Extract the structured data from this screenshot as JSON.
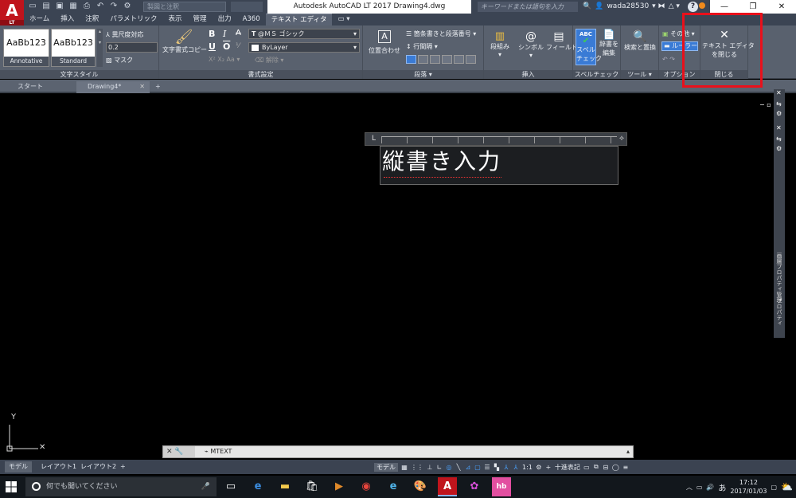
{
  "titlebar": {
    "title": "Autodesk AutoCAD LT 2017    Drawing4.dwg",
    "workspace": "製図と注釈",
    "search_placeholder": "キーワードまたは語句を入力",
    "username": "wada28530",
    "minimize": "—",
    "restore": "❐",
    "close": "✕",
    "logo": "A",
    "logo_sub": "LT",
    "help": "?"
  },
  "ribbon_tabs": [
    "ホーム",
    "挿入",
    "注釈",
    "パラメトリック",
    "表示",
    "管理",
    "出力",
    "A360",
    "テキスト エディタ",
    "▭ ▾"
  ],
  "active_tab_index": 8,
  "ribbon": {
    "style_panel": {
      "sample_text": "AaBb123",
      "style1": "Annotative",
      "style2": "Standard",
      "annotative_label": "異尺度対応",
      "height_value": "0.2",
      "mask_label": "マスク",
      "title": "文字スタイル"
    },
    "format_panel": {
      "match_label": "文字書式コピー",
      "bold": "B",
      "italic": "I",
      "strike": "A",
      "underline": "U",
      "overline": "O",
      "font_value": "@ＭＳ ゴシック",
      "color_value": "ByLayer",
      "clear_label": "解除",
      "title": "書式設定"
    },
    "paragraph_panel": {
      "justify_label": "位置合わせ",
      "bullets_label": "箇条書きと段落番号",
      "line_spacing_label": "行間隔",
      "title": "段落"
    },
    "insert_panel": {
      "columns_label": "段組み",
      "symbol_label": "シンボル",
      "field_label": "フィールド",
      "title": "挿入"
    },
    "spell_panel": {
      "abc": "ABC",
      "spell_label1": "スペル",
      "spell_label2": "チェック",
      "dict_label1": "辞書を",
      "dict_label2": "編集",
      "title": "スペルチェック"
    },
    "tools_panel": {
      "find_label": "検索と置換",
      "title": "ツール"
    },
    "options_panel": {
      "more_label": "その他",
      "ruler_label": "ルーラー",
      "title": "オプション"
    },
    "close_panel": {
      "close_icon": "✕",
      "close_label1": "テキスト エディタ",
      "close_label2": "を閉じる",
      "title": "閉じる"
    }
  },
  "doc_tabs": {
    "start": "スタート",
    "drawing": "Drawing4*",
    "add": "+"
  },
  "mtext": {
    "content": "縦書き入力"
  },
  "right_palette": {
    "label1": "プロパティ",
    "label2": "画層プロパティ管理"
  },
  "commandline": {
    "command": "MTEXT"
  },
  "layout_tabs": [
    "モデル",
    "レイアウト1",
    "レイアウト2"
  ],
  "status": {
    "model": "モデル",
    "scale": "1:1",
    "units": "十進表記"
  },
  "taskbar": {
    "search_placeholder": "何でも聞いてください",
    "time": "17:12",
    "date": "2017/01/03",
    "ime": "あ"
  },
  "colors": {
    "highlight": "#e9101b",
    "ribbon_bg": "#59616e",
    "accent_blue": "#3a7bd5"
  }
}
